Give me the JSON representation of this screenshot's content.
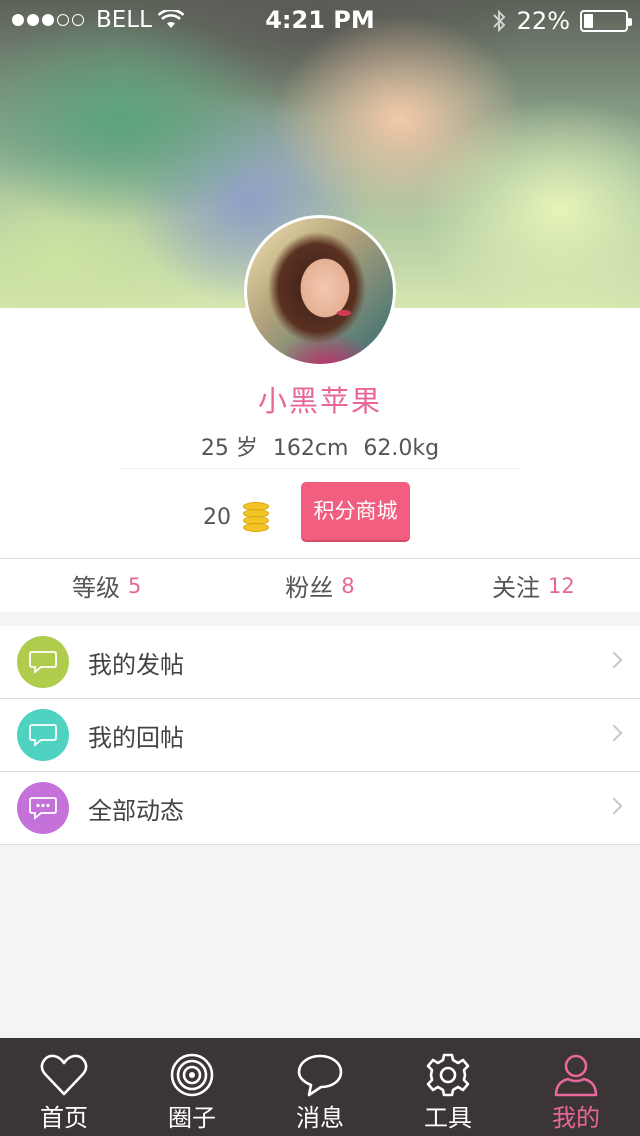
{
  "status_bar": {
    "signal_dots_filled": 3,
    "signal_dots_total": 5,
    "carrier": "BELL",
    "time": "4:21 PM",
    "battery_percent": "22%",
    "battery_level": 0.22
  },
  "profile": {
    "name": "小黑苹果",
    "age": "25 岁",
    "height": "162cm",
    "weight": "62.0kg",
    "coins": "20",
    "mall_button": "积分商城"
  },
  "counters": [
    {
      "label": "等级",
      "value": "5"
    },
    {
      "label": "粉丝",
      "value": "8"
    },
    {
      "label": "关注",
      "value": "12"
    }
  ],
  "menu": [
    {
      "label": "我的发帖",
      "icon": "speech-bubble-icon",
      "color": "#b0cc4d"
    },
    {
      "label": "我的回帖",
      "icon": "speech-bubble-icon",
      "color": "#4fd2c0"
    },
    {
      "label": "全部动态",
      "icon": "chat-dots-icon",
      "color": "#c471d9"
    }
  ],
  "tabs": [
    {
      "label": "首页",
      "icon": "heart-icon"
    },
    {
      "label": "圈子",
      "icon": "circle-rings-icon"
    },
    {
      "label": "消息",
      "icon": "message-bubble-icon"
    },
    {
      "label": "工具",
      "icon": "gear-icon"
    },
    {
      "label": "我的",
      "icon": "person-icon",
      "active": true
    }
  ],
  "colors": {
    "accent": "#e8679a",
    "button": "#f25e7f",
    "tabbar": "#3c3535"
  }
}
